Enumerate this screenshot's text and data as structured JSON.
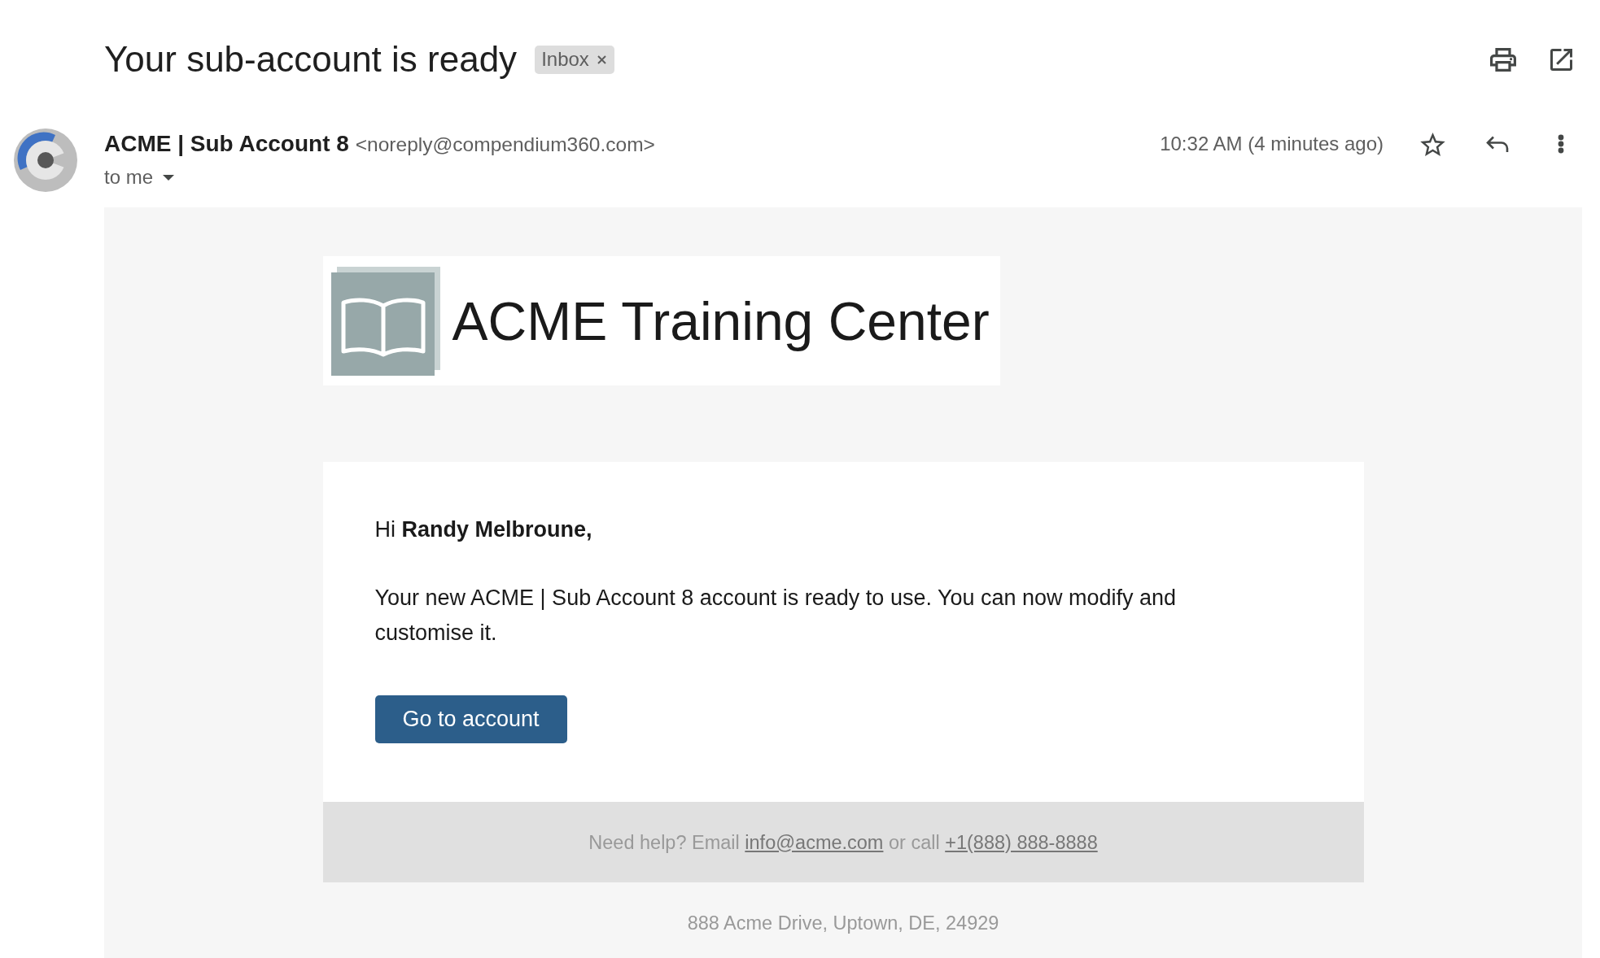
{
  "subject": "Your sub-account is ready",
  "label_chip": {
    "text": "Inbox",
    "removable": true
  },
  "sender": {
    "name": "ACME | Sub Account 8",
    "email": "<noreply@compendium360.com>",
    "recipients": "to me"
  },
  "message_meta": {
    "time": "10:32 AM (4 minutes ago)",
    "starred": false
  },
  "email_body": {
    "logo_text": "ACME Training Center",
    "greeting": "Hi **Randy Melbroune,**",
    "paragraph": "Your new ACME | Sub Account 8 account is ready to use. You can now modify and customise it.",
    "button": "Go to account",
    "help": {
      "prefix": "Need help? Email",
      "email_link": "info@acme.com",
      "middle": "or call",
      "phone_link": "+1(888) 888-8888"
    },
    "address": "888 Acme Drive, Uptown, DE, 24929"
  }
}
